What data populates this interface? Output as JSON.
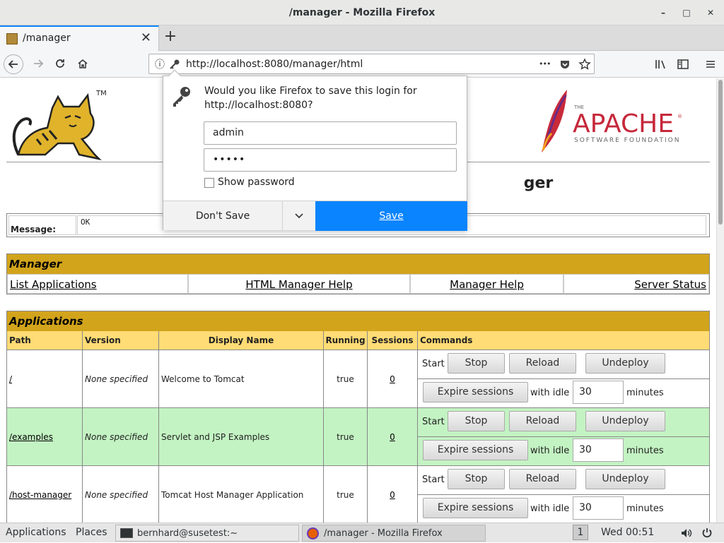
{
  "window": {
    "title": "/manager - Mozilla Firefox",
    "minimize": "–",
    "maximize": "□",
    "close": "✕"
  },
  "tab": {
    "title": "/manager",
    "close": "✕",
    "new_tab": "+"
  },
  "nav": {
    "url": "http://localhost:8080/manager/html",
    "more": "•••"
  },
  "page": {
    "heading": "ger",
    "tomcat_tm": "TM",
    "apache": {
      "the": "THE",
      "name": "APACHE",
      "sub": "SOFTWARE FOUNDATION",
      "reg": "®"
    },
    "message": {
      "label": "Message:",
      "value": "OK"
    },
    "manager": {
      "title": "Manager",
      "links": [
        "List Applications",
        "HTML Manager Help",
        "Manager Help",
        "Server Status"
      ]
    },
    "applications": {
      "title": "Applications",
      "columns": [
        "Path",
        "Version",
        "Display Name",
        "Running",
        "Sessions",
        "Commands"
      ],
      "rows": [
        {
          "path": "/",
          "version": "None specified",
          "display_name": "Welcome to Tomcat",
          "running": "true",
          "sessions": "0",
          "idle": "30"
        },
        {
          "path": "/examples",
          "version": "None specified",
          "display_name": "Servlet and JSP Examples",
          "running": "true",
          "sessions": "0",
          "idle": "30"
        },
        {
          "path": "/host-manager",
          "version": "None specified",
          "display_name": "Tomcat Host Manager Application",
          "running": "true",
          "sessions": "0",
          "idle": "30"
        }
      ],
      "commands": {
        "start": "Start",
        "stop": "Stop",
        "reload": "Reload",
        "undeploy": "Undeploy",
        "expire": "Expire sessions",
        "with_idle": "with idle ≥",
        "minutes": "minutes"
      }
    }
  },
  "popup": {
    "message": "Would you like Firefox to save this login for http://localhost:8080?",
    "username": "admin",
    "password": "•••••",
    "show_password": "Show password",
    "dont_save": "Don't Save",
    "save": "Save"
  },
  "taskbar": {
    "applications": "Applications",
    "places": "Places",
    "terminal": "bernhard@susetest:~",
    "firefox": "/manager - Mozilla Firefox",
    "workspace": "1",
    "clock": "Wed 00:51"
  },
  "colors": {
    "section_header": "#d2a41c",
    "column_header": "#ffdc75",
    "row_alt": "#c3f3c3",
    "save_button": "#0a84ff"
  }
}
